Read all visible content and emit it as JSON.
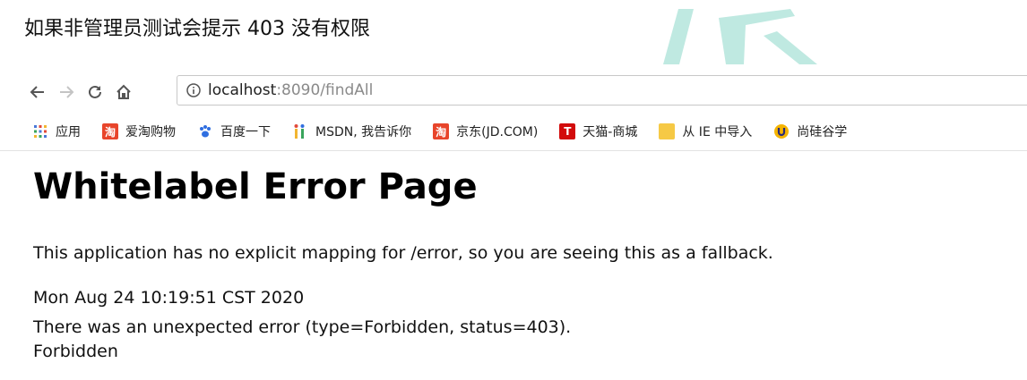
{
  "caption": "如果非管理员测试会提示 403 没有权限",
  "browser": {
    "url_host": "localhost",
    "url_rest": ":8090/findAll"
  },
  "bookmarks": [
    {
      "label": "应用",
      "icon": "apps-grid-icon"
    },
    {
      "label": "爱淘购物",
      "icon": "taobao-icon"
    },
    {
      "label": "百度一下",
      "icon": "baidu-paw-icon"
    },
    {
      "label": "MSDN, 我告诉你",
      "icon": "msdn-icon"
    },
    {
      "label": "京东(JD.COM)",
      "icon": "taobao-icon"
    },
    {
      "label": "天猫-商城",
      "icon": "tmall-icon"
    },
    {
      "label": "从 IE 中导入",
      "icon": "folder-icon"
    },
    {
      "label": "尚硅谷学",
      "icon": "atguigu-icon"
    }
  ],
  "page": {
    "heading": "Whitelabel Error Page",
    "message": "This application has no explicit mapping for /error, so you are seeing this as a fallback.",
    "timestamp": "Mon Aug 24 10:19:51 CST 2020",
    "error_line": "There was an unexpected error (type=Forbidden, status=403).",
    "status_text": "Forbidden"
  },
  "colors": {
    "watermark": "#bfe9e1",
    "taobao": "#e8452b",
    "tmall": "#d20b0b",
    "baidu": "#2f6ee0",
    "folder": "#f6c945",
    "atguigu": "#f5b400"
  }
}
